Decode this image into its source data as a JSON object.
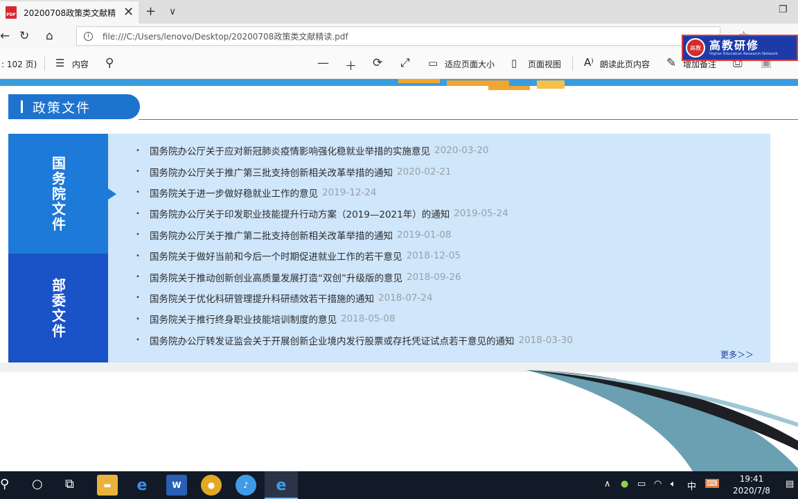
{
  "browser": {
    "tab_title": "20200708政策类文献精",
    "tab_close": "✕",
    "new_tab": "+",
    "tab_menu": "∨",
    "url": "file:///C:/Users/lenovo/Desktop/20200708政策类文献精读.pdf"
  },
  "logo": {
    "name_cn": "高教研修"
  },
  "pdf_toolbar": {
    "page_info": ": 102 页)",
    "contents": "内容",
    "fit_page": "适应页面大小",
    "page_view": "页面视图",
    "read_aloud": "朗读此页内容",
    "add_notes": "增加备注"
  },
  "document": {
    "section_title": "政策文件",
    "side_tab_1": "国务院文件",
    "side_tab_2": "部委文件",
    "items": [
      {
        "title": "国务院办公厅关于应对新冠肺炎疫情影响强化稳就业举措的实施意见",
        "date": "2020-03-20"
      },
      {
        "title": "国务院办公厅关于推广第三批支持创新相关改革举措的通知",
        "date": "2020-02-21"
      },
      {
        "title": "国务院关于进一步做好稳就业工作的意见",
        "date": "2019-12-24"
      },
      {
        "title": "国务院办公厅关于印发职业技能提升行动方案（2019—2021年）的通知",
        "date": "2019-05-24"
      },
      {
        "title": "国务院办公厅关于推广第二批支持创新相关改革举措的通知",
        "date": "2019-01-08"
      },
      {
        "title": "国务院关于做好当前和今后一个时期促进就业工作的若干意见",
        "date": "2018-12-05"
      },
      {
        "title": "国务院关于推动创新创业高质量发展打造“双创”升级版的意见",
        "date": "2018-09-26"
      },
      {
        "title": "国务院关于优化科研管理提升科研绩效若干措施的通知",
        "date": "2018-07-24"
      },
      {
        "title": "国务院关于推行终身职业技能培训制度的意见",
        "date": "2018-05-08"
      },
      {
        "title": "国务院办公厅转发证监会关于开展创新企业境内发行股票或存托凭证试点若干意见的通知",
        "date": "2018-03-30"
      }
    ],
    "more": "更多＞＞"
  },
  "taskbar": {
    "ime": "中",
    "time": "19:41",
    "date": "2020/7/8"
  },
  "colors": {
    "accent_blue": "#1e73cf",
    "dark_blue": "#1a52c8",
    "list_bg": "#cfe6fb",
    "taskbar": "#111a26"
  }
}
